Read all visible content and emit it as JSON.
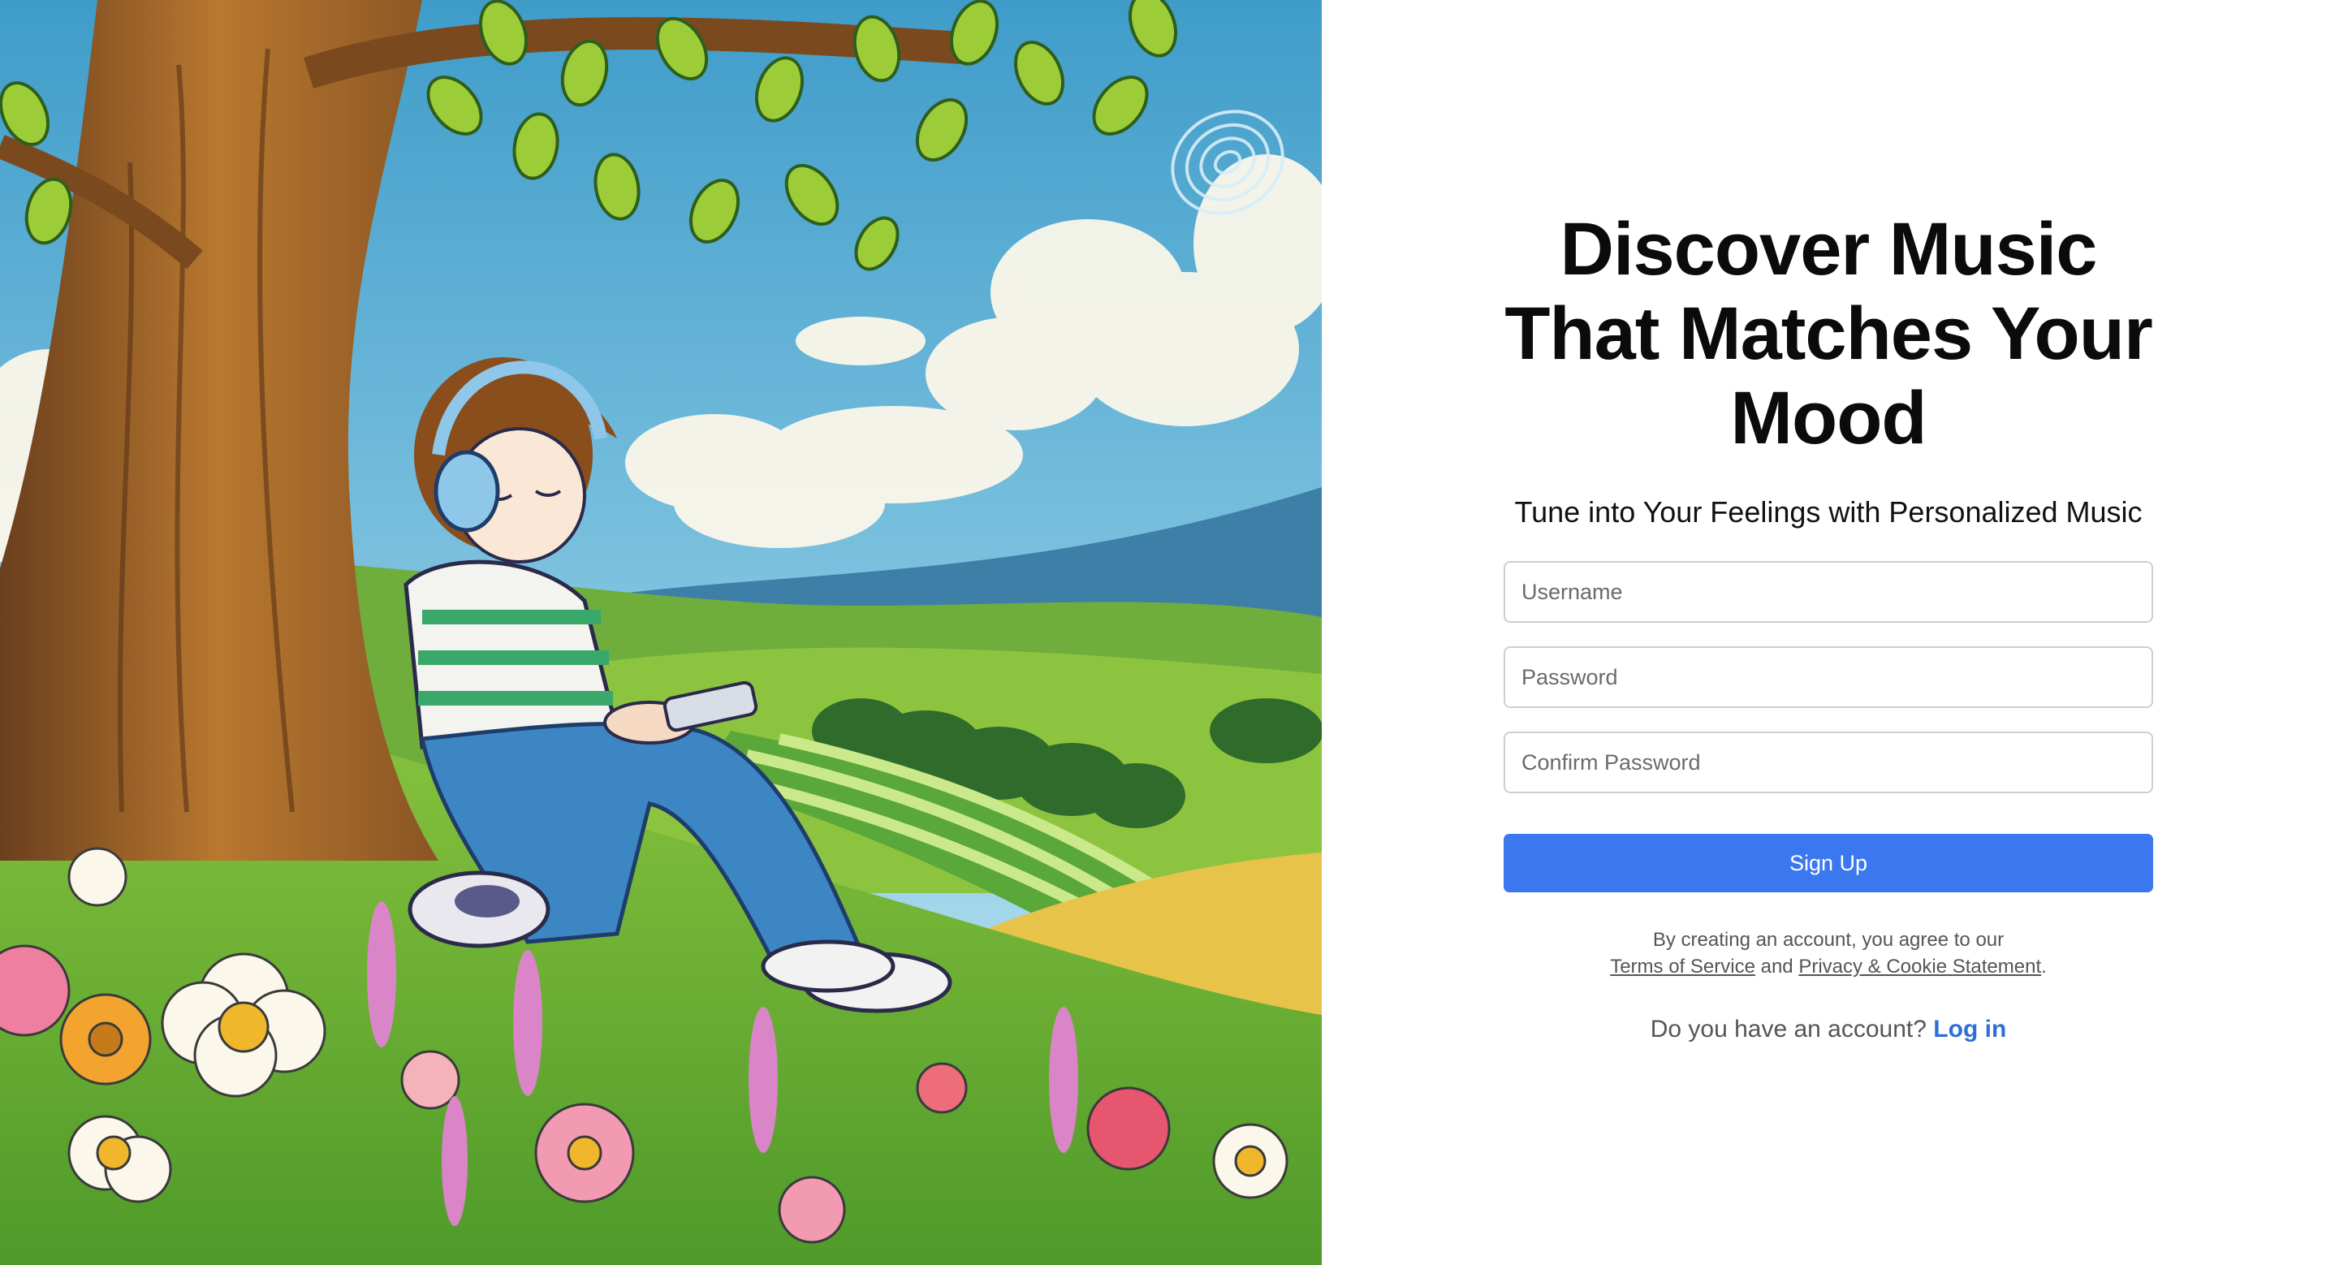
{
  "page": {
    "accent_color": "#3b78f0",
    "link_color": "#2f6fd4"
  },
  "hero": {
    "image_alt": "Illustration of a girl with headphones sitting under a tree on a grassy hill with flowers"
  },
  "signup": {
    "title": "Discover Music That Matches Your Mood",
    "subtitle": "Tune into Your Feelings with Personalized Music",
    "username_placeholder": "Username",
    "username_value": "",
    "password_placeholder": "Password",
    "password_value": "",
    "confirm_password_placeholder": "Confirm Password",
    "confirm_password_value": "",
    "submit_label": "Sign Up",
    "terms_prefix": "By creating an account, you agree to our",
    "terms_link": "Terms of Service",
    "terms_and": "and",
    "privacy_link": "Privacy & Cookie Statement",
    "terms_suffix": ".",
    "login_prompt": "Do you have an account?",
    "login_link": "Log in"
  }
}
